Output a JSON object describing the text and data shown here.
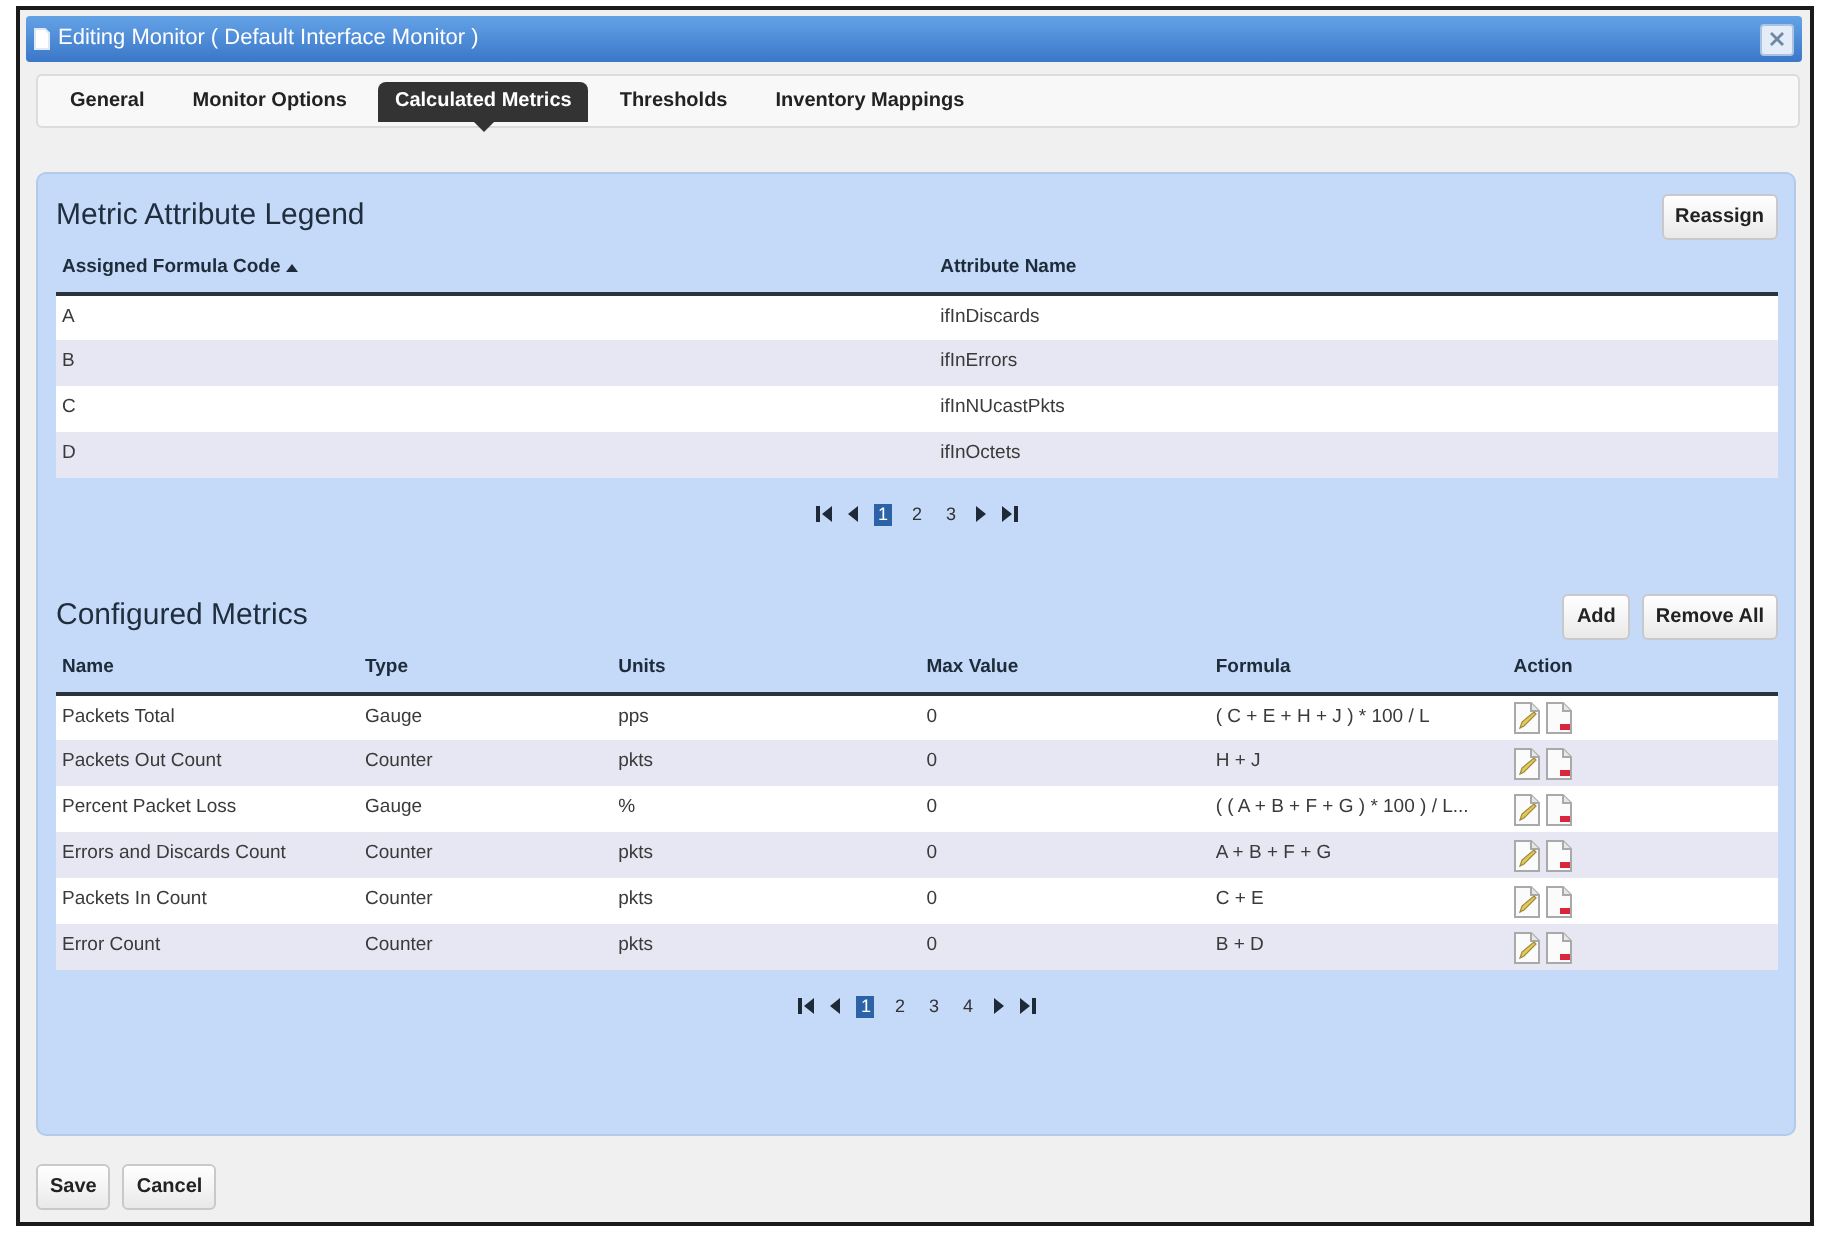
{
  "window": {
    "title": "Editing Monitor ( Default Interface Monitor )"
  },
  "tabs": [
    {
      "label": "General",
      "selected": false
    },
    {
      "label": "Monitor Options",
      "selected": false
    },
    {
      "label": "Calculated Metrics",
      "selected": true
    },
    {
      "label": "Thresholds",
      "selected": false
    },
    {
      "label": "Inventory Mappings",
      "selected": false
    }
  ],
  "legend": {
    "title": "Metric Attribute Legend",
    "buttons": [
      "Reassign"
    ],
    "columns": [
      {
        "label": "Assigned Formula Code",
        "sorted": true
      },
      {
        "label": "Attribute Name",
        "sorted": false
      }
    ],
    "rows": [
      [
        "A",
        "ifInDiscards"
      ],
      [
        "B",
        "ifInErrors"
      ],
      [
        "C",
        "ifInNUcastPkts"
      ],
      [
        "D",
        "ifInOctets"
      ]
    ],
    "pager": {
      "pages": [
        {
          "label": "1",
          "selected": true
        },
        {
          "label": "2",
          "selected": false
        },
        {
          "label": "3",
          "selected": false
        }
      ]
    }
  },
  "metrics": {
    "title": "Configured Metrics",
    "buttons": [
      "Add",
      "Remove All"
    ],
    "columns": [
      {
        "label": "Name",
        "kind": "text"
      },
      {
        "label": "Type",
        "kind": "text"
      },
      {
        "label": "Units",
        "kind": "text"
      },
      {
        "label": "Max Value",
        "kind": "text"
      },
      {
        "label": "Formula",
        "kind": "text"
      },
      {
        "label": "Action",
        "kind": "actions"
      }
    ],
    "rows": [
      [
        "Packets Total",
        "Gauge",
        "pps",
        "0",
        "( C + E + H + J ) * 100 / L"
      ],
      [
        "Packets Out Count",
        "Counter",
        "pkts",
        "0",
        "H + J"
      ],
      [
        "Percent Packet Loss",
        "Gauge",
        "%",
        "0",
        "( ( A + B + F + G ) * 100 ) / L..."
      ],
      [
        "Errors and Discards Count",
        "Counter",
        "pkts",
        "0",
        "A + B + F + G"
      ],
      [
        "Packets In Count",
        "Counter",
        "pkts",
        "0",
        "C + E"
      ],
      [
        "Error Count",
        "Counter",
        "pkts",
        "0",
        "B + D"
      ]
    ],
    "pager": {
      "pages": [
        {
          "label": "1",
          "selected": true
        },
        {
          "label": "2",
          "selected": false
        },
        {
          "label": "3",
          "selected": false
        },
        {
          "label": "4",
          "selected": false
        }
      ]
    }
  },
  "footer": {
    "buttons": [
      "Save",
      "Cancel"
    ]
  }
}
